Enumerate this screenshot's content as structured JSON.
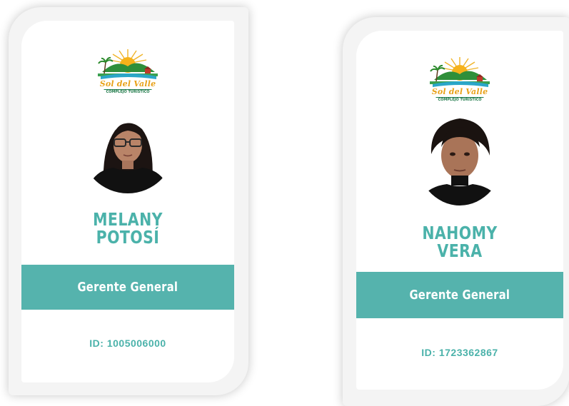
{
  "cards": [
    {
      "logo": {
        "title": "Sol del Valle",
        "subtitle": "COMPLEJO TURISTICO"
      },
      "name_line1": "MELANY",
      "name_line2": "POTOSÍ",
      "role": "Gerente General",
      "id_text": "ID: 1005006000"
    },
    {
      "logo": {
        "title": "Sol del Valle",
        "subtitle": "COMPLEJO TURISTICO"
      },
      "name_line1": "NAHOMY",
      "name_line2": "VERA",
      "role": "Gerente General",
      "id_text": "ID: 1723362867"
    }
  ],
  "colors": {
    "accent": "#55b3ad",
    "name_text": "#4bb2aa",
    "logo_gold": "#e9a21a",
    "logo_green": "#1f7a4a"
  },
  "icons": [
    "sun-icon",
    "mountain-icon",
    "palm-tree-icon",
    "house-icon"
  ]
}
